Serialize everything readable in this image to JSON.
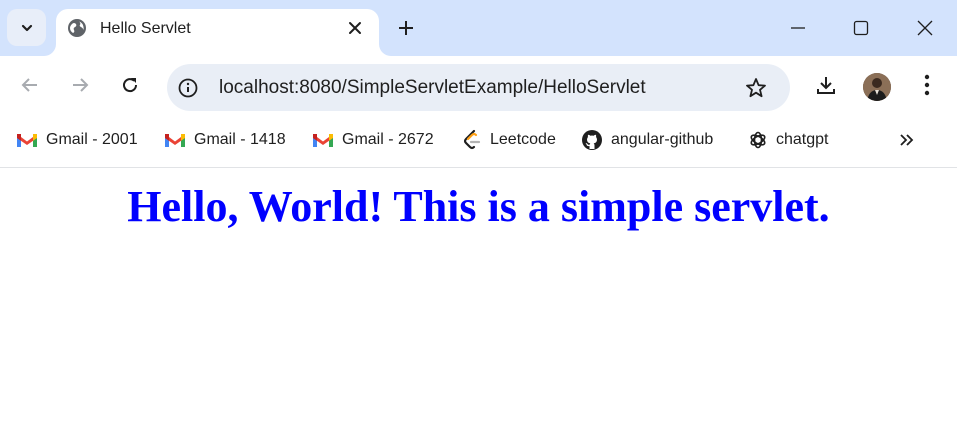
{
  "tab": {
    "title": "Hello Servlet"
  },
  "address_bar": {
    "url": "localhost:8080/SimpleServletExample/HelloServlet"
  },
  "bookmarks": [
    {
      "label": "Gmail - 2001",
      "icon": "gmail-icon"
    },
    {
      "label": "Gmail - 1418",
      "icon": "gmail-icon"
    },
    {
      "label": "Gmail - 2672",
      "icon": "gmail-icon"
    },
    {
      "label": "Leetcode",
      "icon": "leetcode-icon"
    },
    {
      "label": "angular-github",
      "icon": "github-icon"
    },
    {
      "label": "chatgpt",
      "icon": "chatgpt-icon"
    }
  ],
  "page": {
    "heading": "Hello, World! This is a simple servlet."
  },
  "colors": {
    "tabstrip": "#d3e3fd",
    "omnibox": "#e9eef6",
    "heading": "#0000ff"
  }
}
